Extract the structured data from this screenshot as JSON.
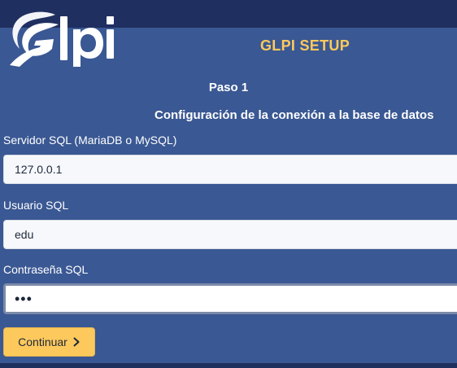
{
  "header": {
    "logo_text": "Glpi",
    "title": "GLPI SETUP"
  },
  "step": {
    "title": "Paso 1",
    "subtitle": "Configuración de la conexión a la base de datos"
  },
  "form": {
    "server": {
      "label": "Servidor SQL (MariaDB o MySQL)",
      "value": "127.0.0.1"
    },
    "user": {
      "label": "Usuario SQL",
      "value": "edu"
    },
    "password": {
      "label": "Contraseña SQL",
      "value": "•••"
    }
  },
  "actions": {
    "continue_label": "Continuar",
    "continue_icon": "chevron-right-icon"
  },
  "colors": {
    "panel": "#3a5893",
    "dark": "#1f2f5e",
    "accent": "#fec95c"
  }
}
